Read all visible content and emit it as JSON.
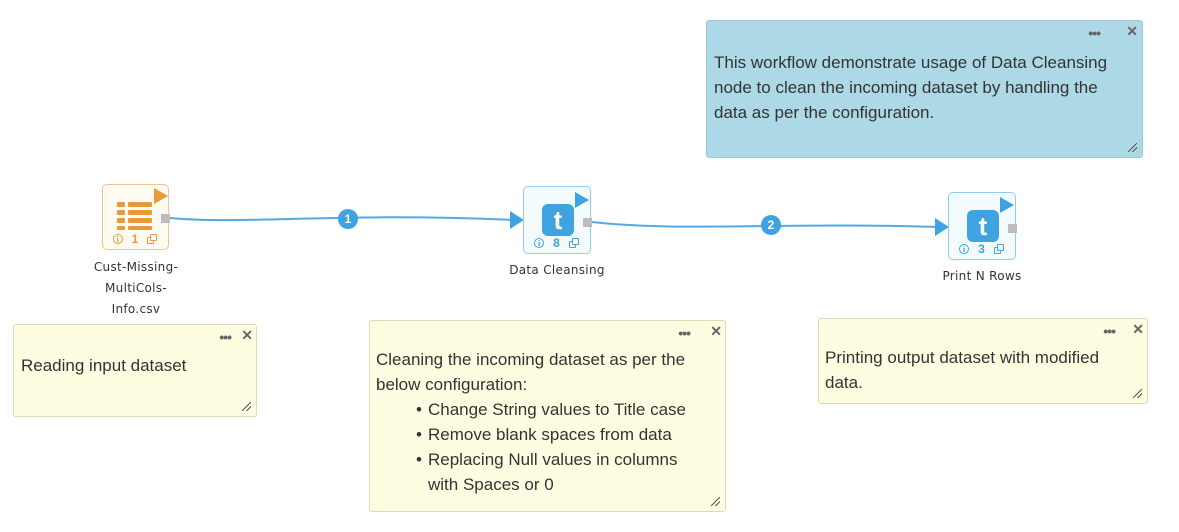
{
  "canvas": {
    "edges": [
      {
        "id": "edge-1",
        "badge": "1"
      },
      {
        "id": "edge-2",
        "badge": "2"
      }
    ]
  },
  "nodes": {
    "csv": {
      "label_lines": [
        "Cust-Missing-",
        "MultiCols-",
        "Info.csv"
      ],
      "id_number": "1",
      "info_symbol": "i",
      "icon": "table-list-icon",
      "color": "#e89a3c"
    },
    "cleansing": {
      "label": "Data Cleansing",
      "id_number": "8",
      "info_symbol": "i",
      "glyph": "t",
      "icon": "transform-t-icon",
      "color": "#3ea3e0"
    },
    "print": {
      "label": "Print N Rows",
      "id_number": "3",
      "info_symbol": "i",
      "glyph": "t",
      "icon": "transform-t-icon",
      "color": "#3ea3e0"
    }
  },
  "notes": {
    "description": {
      "text": "This workflow demonstrate usage of Data Cleansing node to clean the incoming dataset by handling the data as per the configuration.",
      "color": "#add8e6"
    },
    "reading": {
      "text": "Reading input dataset",
      "color": "#fffde1"
    },
    "cleaning": {
      "intro": "Cleaning the incoming dataset as per the below configuration:",
      "bullets": [
        "Change String values to Title case",
        "Remove blank spaces from data",
        "Replacing Null values in columns with Spaces or 0"
      ],
      "color": "#fffde1"
    },
    "printing": {
      "text": "Printing output dataset with modified data.",
      "color": "#fffde1"
    }
  },
  "note_controls": {
    "menu_glyph": "•••",
    "close_glyph": "✕"
  },
  "accent": "#3ea3e0"
}
